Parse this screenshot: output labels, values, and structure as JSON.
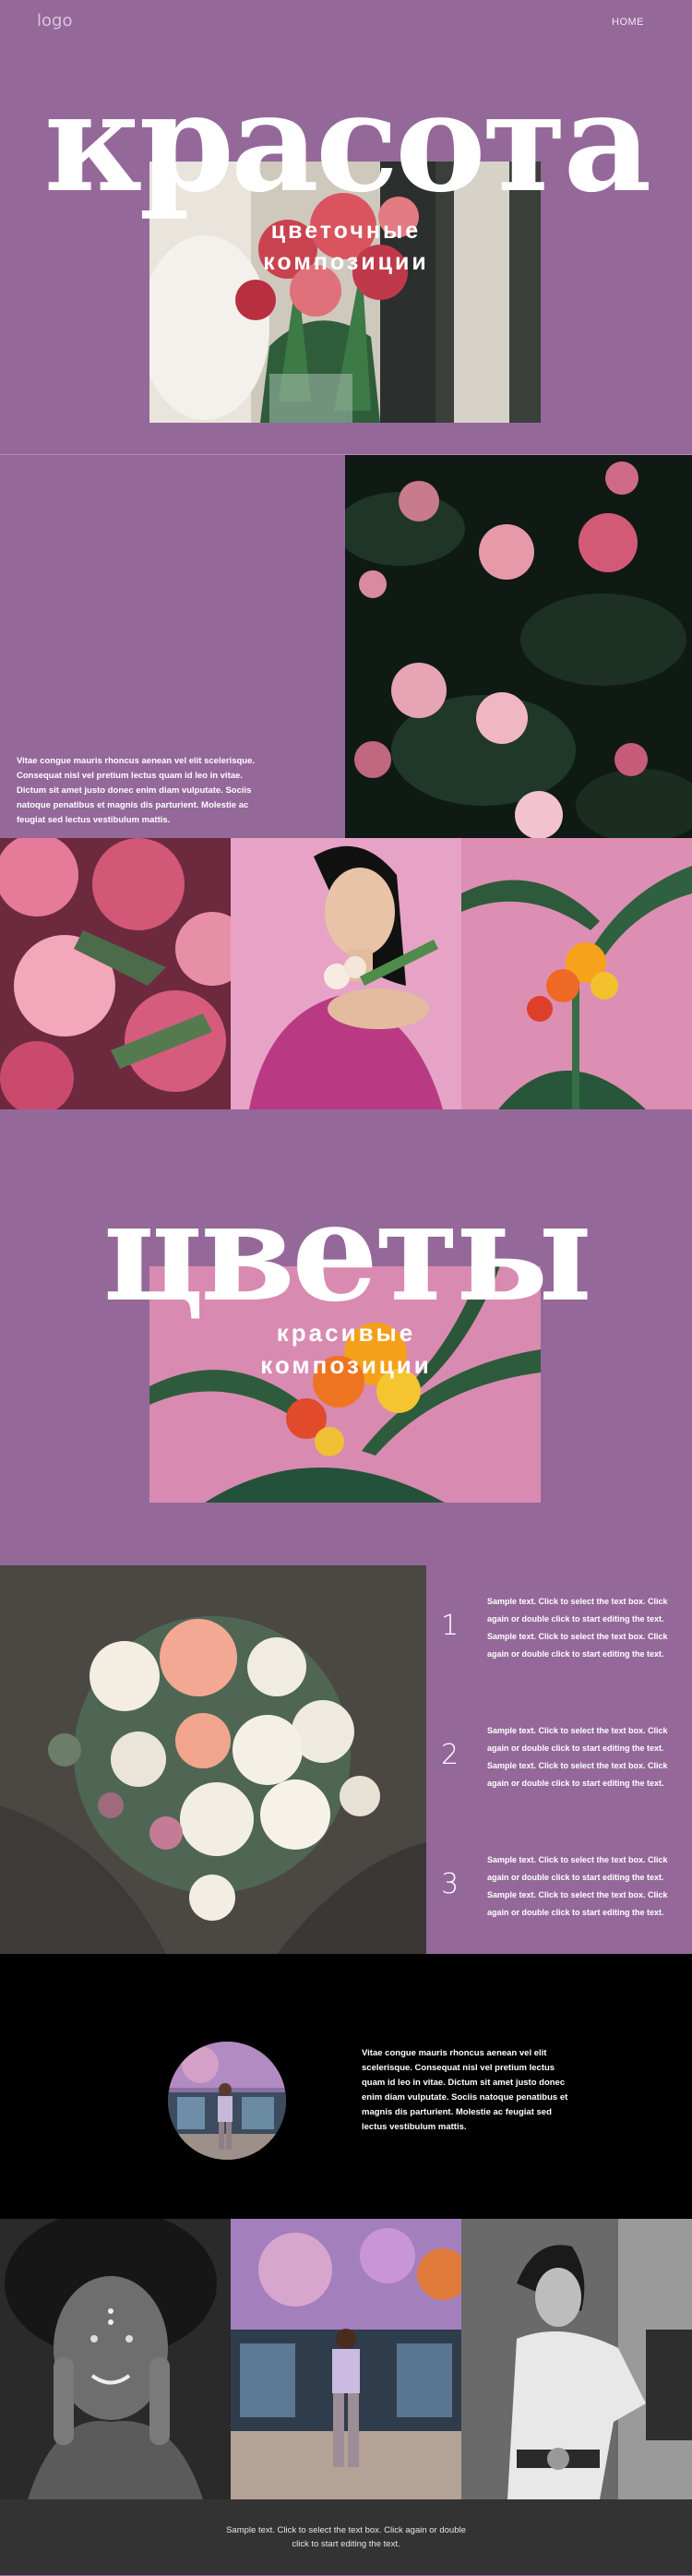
{
  "header": {
    "logo": "logo",
    "nav_home": "HOME"
  },
  "hero": {
    "title": "красота",
    "subtitle_line1": "цветочные",
    "subtitle_line2": "композиции"
  },
  "section2": {
    "text": "Vitae congue mauris rhoncus aenean vel elit scelerisque. Consequat nisl vel pretium lectus quam id leo in vitae. Dictum sit amet justo donec enim diam vulputate. Sociis natoque penatibus et magnis dis parturient. Molestie ac feugiat sed lectus vestibulum mattis."
  },
  "section4": {
    "title": "цветы",
    "subtitle_line1": "красивые",
    "subtitle_line2": "композиции"
  },
  "list": {
    "items": [
      {
        "number": "1",
        "text": "Sample text. Click to select the text box. Click again or double click to start editing the text. Sample text. Click to select the text box. Click again or double click to start editing the text."
      },
      {
        "number": "2",
        "text": "Sample text. Click to select the text box. Click again or double click to start editing the text. Sample text. Click to select the text box. Click again or double click to start editing the text."
      },
      {
        "number": "3",
        "text": "Sample text. Click to select the text box. Click again or double click to start editing the text. Sample text. Click to select the text box. Click again or double click to start editing the text."
      }
    ]
  },
  "section6": {
    "text": "Vitae congue mauris rhoncus aenean vel elit scelerisque. Consequat nisl vel pretium lectus quam id leo in vitae. Dictum sit amet justo donec enim diam vulputate. Sociis natoque penatibus et magnis dis parturient. Molestie ac feugiat sed lectus vestibulum mattis."
  },
  "footer": {
    "text": "Sample text. Click to select the text box. Click again or double click to start editing the text."
  },
  "colors": {
    "page_bg": "#95689a",
    "dark_bg": "#000000",
    "footer_bg": "#333333"
  }
}
